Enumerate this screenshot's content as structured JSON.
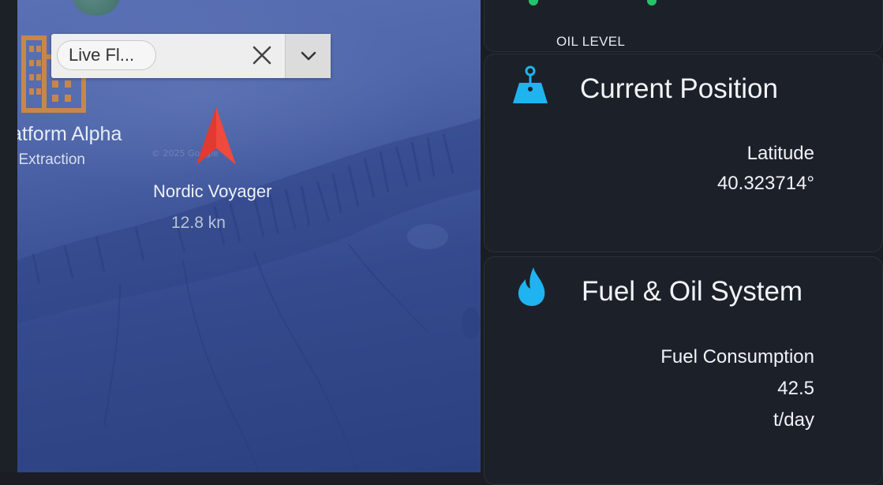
{
  "map": {
    "layer_selector": {
      "chip_label": "Live Fl..."
    },
    "platform": {
      "name": "atform Alpha",
      "subtitle": "l Extraction"
    },
    "vessel": {
      "name": "Nordic Voyager",
      "speed": "12.8 kn"
    },
    "watermark": "© 2025 Google",
    "colors": {
      "vessel_marker": "#f0493e",
      "platform_icon": "#c8874a",
      "ocean": "#3f559a"
    }
  },
  "panel": {
    "oil_level": {
      "label": "OIL LEVEL"
    },
    "position_card": {
      "title": "Current Position",
      "icon": "map-pin-icon",
      "metric_label": "Latitude",
      "metric_value": "40.323714°"
    },
    "fuel_card": {
      "title": "Fuel & Oil System",
      "icon": "flame-icon",
      "metric_label": "Fuel Consumption",
      "metric_value": "42.5",
      "metric_unit": "t/day"
    },
    "colors": {
      "accent": "#1fb3f0",
      "status_ok": "#26c26a",
      "card_bg": "#1c2129"
    }
  }
}
